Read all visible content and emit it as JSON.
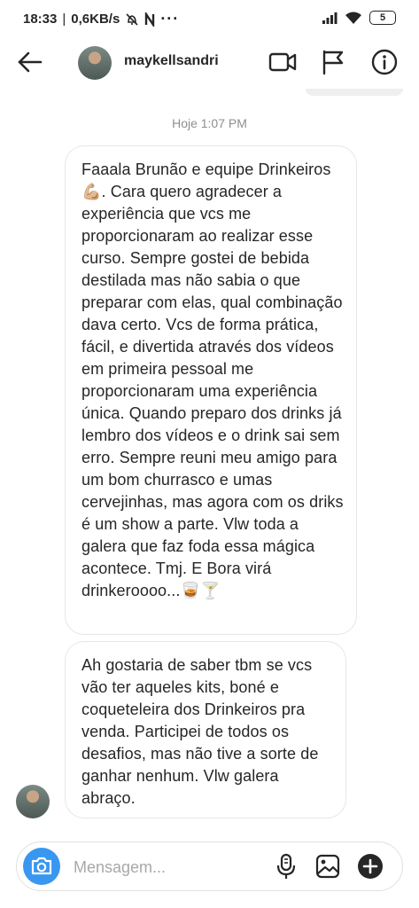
{
  "status_bar": {
    "time": "18:33",
    "separator": "|",
    "speed": "0,6KB/s",
    "extra": "···",
    "battery": "5",
    "icons": [
      "alarm-off-icon",
      "n-icon",
      "signal-icon",
      "wifi-icon",
      "battery-icon"
    ]
  },
  "header": {
    "username": "maykellsandri",
    "icons": [
      "back-arrow-icon",
      "video-call-icon",
      "flag-icon",
      "info-icon"
    ]
  },
  "thread": {
    "timestamp": "Hoje 1:07 PM",
    "messages": [
      {
        "text": "Faaala Brunão e equipe Drinkeiros💪🏼. Cara quero agradecer a experiência que vcs me proporcionaram ao realizar esse curso. Sempre gostei de bebida destilada mas não sabia o que preparar com elas, qual combinação dava certo. Vcs de forma prática, fácil, e divertida através dos vídeos em primeira pessoal me proporcionaram uma experiência única. Quando preparo dos drinks já lembro dos vídeos e o drink sai sem erro. Sempre reuni meu amigo para um bom churrasco e umas cervejinhas, mas agora com os driks é um show a parte. Vlw toda a galera que faz foda essa mágica acontece. Tmj. E Bora virá drinkeroooo...🥃🍸"
      },
      {
        "text": "Ah gostaria de saber tbm se vcs vão ter aqueles kits, boné e coqueteleira dos Drinkeiros pra venda. Participei de todos os desafios, mas não tive a sorte de ganhar nenhum. Vlw galera abraço."
      }
    ]
  },
  "composer": {
    "placeholder": "Mensagem...",
    "value": "",
    "icons": [
      "camera-icon",
      "microphone-icon",
      "gallery-icon",
      "add-icon"
    ]
  },
  "colors": {
    "accent": "#3897f0",
    "text": "#262626",
    "secondary_text": "#8e8e8e",
    "bubble_border": "#e6e6e6"
  }
}
